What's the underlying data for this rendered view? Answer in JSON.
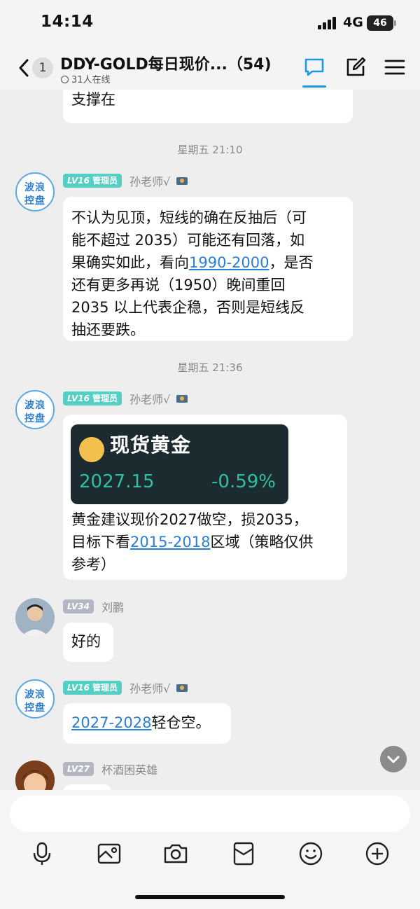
{
  "status_bar": {
    "time": "14:14",
    "network": "4G",
    "battery": "46"
  },
  "header": {
    "back_badge": "1",
    "title": "DDY-GOLD每日现价...（54)",
    "online": "31人在线"
  },
  "messages": {
    "partial_bubble": "支撑在",
    "timestamp_1": "星期五 21:10",
    "msg1": {
      "level": "LV16",
      "role": "管理员",
      "sender": "孙老师√",
      "avatar_line1": "波浪",
      "avatar_line2": "控盘",
      "line1": "不认为见顶，短线的确在反抽后（可",
      "line2": "能不超过 2035）可能还有回落，如",
      "line3_pre": "果确实如此，看向",
      "line3_link": "1990-2000",
      "line3_post": "，是否",
      "line4": "还有更多再说（1950）晚间重回",
      "line5": "2035 以上代表企稳，否则是短线反",
      "line6": "抽还要跌。"
    },
    "timestamp_2": "星期五 21:36",
    "msg2": {
      "level": "LV16",
      "role": "管理员",
      "sender": "孙老师√",
      "avatar_line1": "波浪",
      "avatar_line2": "控盘",
      "card_title": "现货黄金",
      "card_price": "2027.15",
      "card_change": "-0.59%",
      "line1": "黄金建议现价2027做空，损2035，",
      "line2_pre": "目标下看",
      "line2_link": "2015-2018",
      "line2_post": "区域（策略仅供",
      "line3": "参考）"
    },
    "msg3": {
      "level": "LV34",
      "sender": "刘鹏",
      "text": "好的"
    },
    "msg4": {
      "level": "LV16",
      "role": "管理员",
      "sender": "孙老师√",
      "avatar_line1": "波浪",
      "avatar_line2": "控盘",
      "link": "2027-2028",
      "text": "轻仓空。"
    },
    "msg5": {
      "level": "LV27",
      "sender": "杯酒困英雄"
    }
  },
  "colors": {
    "accent": "#1b9ae4",
    "link": "#2a7fd6",
    "level_teal": "#53d0c3",
    "price_green": "#2fc0a4"
  },
  "icons": [
    "back-icon",
    "chat-icon",
    "edit-icon",
    "menu-icon",
    "chevron-down-icon",
    "mic-icon",
    "image-icon",
    "camera-icon",
    "red-packet-icon",
    "emoji-icon",
    "plus-icon"
  ]
}
